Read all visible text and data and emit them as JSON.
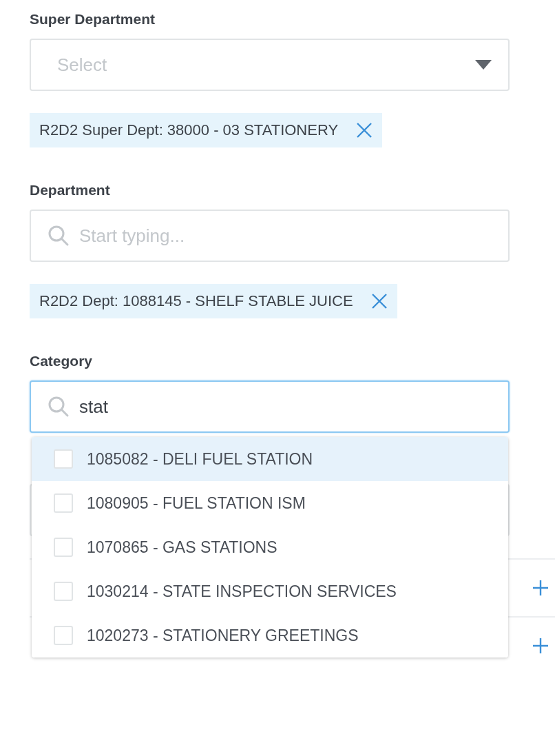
{
  "super_department": {
    "label": "Super Department",
    "placeholder": "Select",
    "chips": [
      {
        "text": "R2D2 Super Dept: 38000 - 03 STATIONERY"
      }
    ]
  },
  "department": {
    "label": "Department",
    "placeholder": "Start typing...",
    "chips": [
      {
        "text": "R2D2 Dept: 1088145 - SHELF STABLE JUICE"
      }
    ]
  },
  "category": {
    "label": "Category",
    "value": "stat",
    "focused": true,
    "options": [
      {
        "text": "1085082 - DELI FUEL STATION",
        "checked": false,
        "selected": true
      },
      {
        "text": "1080905 - FUEL STATION ISM",
        "checked": false,
        "selected": false
      },
      {
        "text": "1070865 - GAS STATIONS",
        "checked": false,
        "selected": false
      },
      {
        "text": "1030214 - STATE INSPECTION SERVICES",
        "checked": false,
        "selected": false
      },
      {
        "text": "1020273 - STATIONERY GREETINGS",
        "checked": false,
        "selected": false
      }
    ]
  },
  "accordion": [
    {
      "expanded": false
    },
    {
      "expanded": false
    }
  ]
}
